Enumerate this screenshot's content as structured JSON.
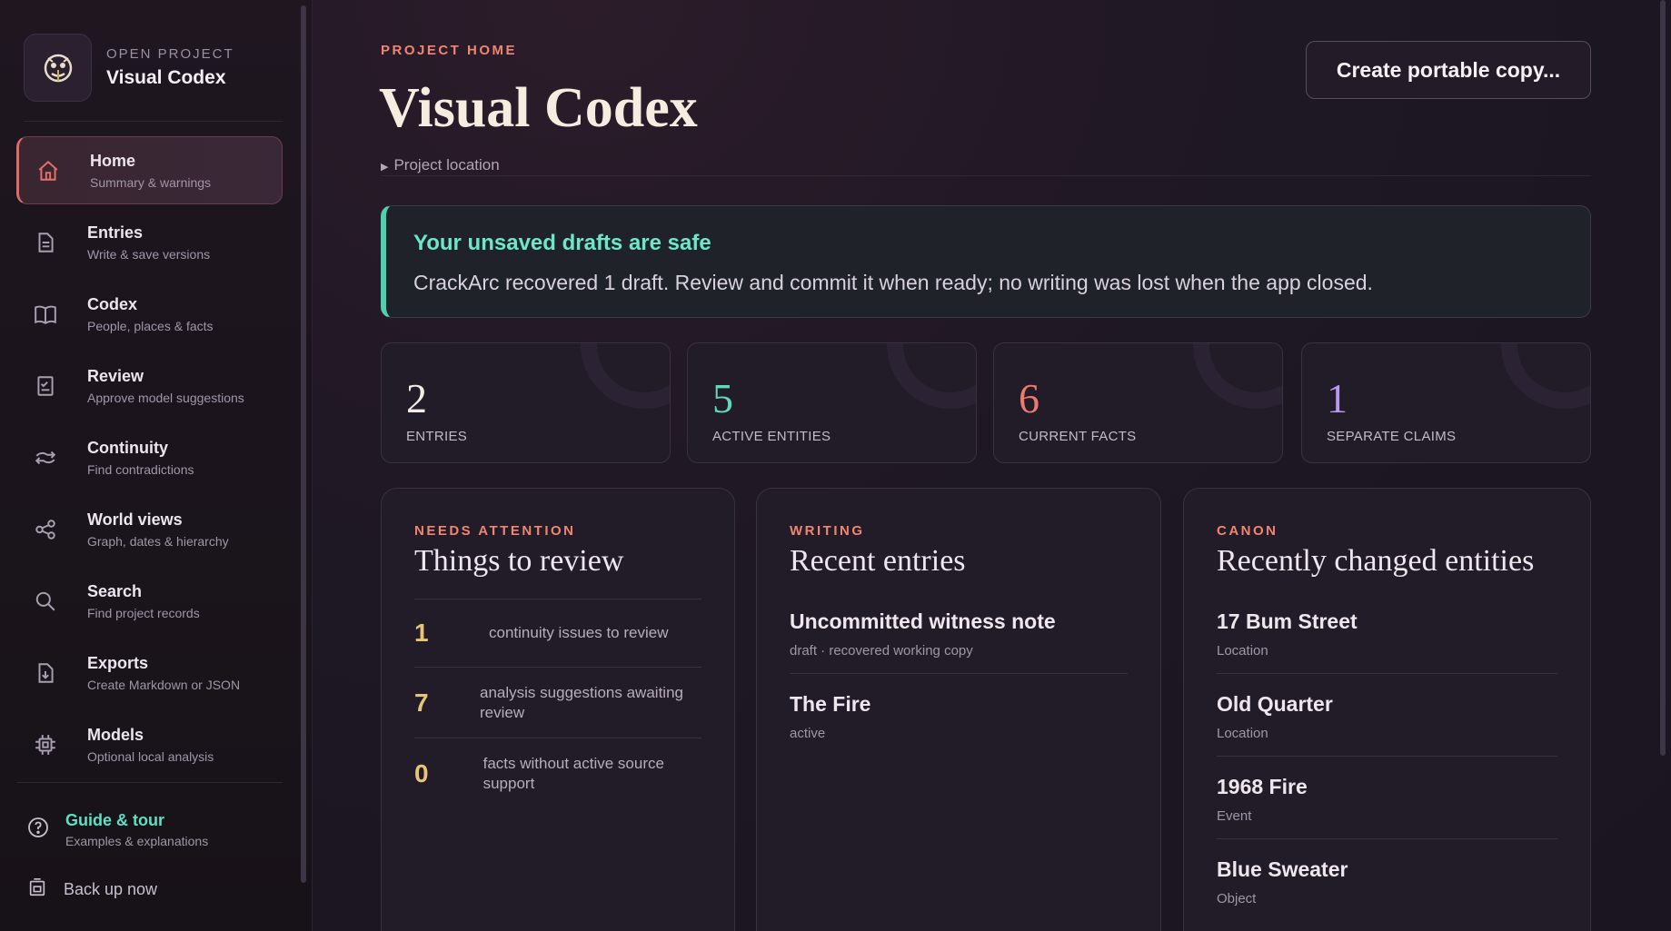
{
  "sidebar": {
    "project_label": "OPEN PROJECT",
    "project_name": "Visual Codex",
    "nav": [
      {
        "title": "Home",
        "subtitle": "Summary & warnings",
        "icon": "home-icon",
        "active": true
      },
      {
        "title": "Entries",
        "subtitle": "Write & save versions",
        "icon": "document-icon"
      },
      {
        "title": "Codex",
        "subtitle": "People, places & facts",
        "icon": "book-icon"
      },
      {
        "title": "Review",
        "subtitle": "Approve model suggestions",
        "icon": "checklist-icon"
      },
      {
        "title": "Continuity",
        "subtitle": "Find contradictions",
        "icon": "arrows-icon"
      },
      {
        "title": "World views",
        "subtitle": "Graph, dates & hierarchy",
        "icon": "share-graph-icon"
      },
      {
        "title": "Search",
        "subtitle": "Find project records",
        "icon": "search-icon"
      },
      {
        "title": "Exports",
        "subtitle": "Create Markdown or JSON",
        "icon": "download-icon"
      },
      {
        "title": "Models",
        "subtitle": "Optional local analysis",
        "icon": "chip-icon"
      }
    ],
    "guide": {
      "title": "Guide & tour",
      "subtitle": "Examples & explanations"
    },
    "backup_label": "Back up now"
  },
  "header": {
    "eyebrow": "PROJECT HOME",
    "title": "Visual Codex",
    "create_button": "Create portable copy...",
    "location_label": "Project location"
  },
  "banner": {
    "title": "Your unsaved drafts are safe",
    "text": "CrackArc recovered 1 draft. Review and commit it when ready; no writing was lost when the app closed."
  },
  "stats": [
    {
      "value": "2",
      "label": "ENTRIES",
      "color": "#f3ece6"
    },
    {
      "value": "5",
      "label": "ACTIVE ENTITIES",
      "color": "#5fd8bf"
    },
    {
      "value": "6",
      "label": "CURRENT FACTS",
      "color": "#f07a6a"
    },
    {
      "value": "1",
      "label": "SEPARATE CLAIMS",
      "color": "#b79af0"
    }
  ],
  "review_card": {
    "eyebrow": "NEEDS ATTENTION",
    "title": "Things to review",
    "rows": [
      {
        "count": "1",
        "text": "continuity issues to review"
      },
      {
        "count": "7",
        "text": "analysis suggestions awaiting review"
      },
      {
        "count": "0",
        "text": "facts without active source support"
      }
    ]
  },
  "entries_card": {
    "eyebrow": "WRITING",
    "title": "Recent entries",
    "items": [
      {
        "title": "Uncommitted witness note",
        "sub": "draft · recovered working copy"
      },
      {
        "title": "The Fire",
        "sub": "active"
      }
    ]
  },
  "canon_card": {
    "eyebrow": "CANON",
    "title": "Recently changed entities",
    "items": [
      {
        "title": "17 Bum Street",
        "sub": "Location"
      },
      {
        "title": "Old Quarter",
        "sub": "Location"
      },
      {
        "title": "1968 Fire",
        "sub": "Event"
      },
      {
        "title": "Blue Sweater",
        "sub": "Object"
      }
    ]
  }
}
